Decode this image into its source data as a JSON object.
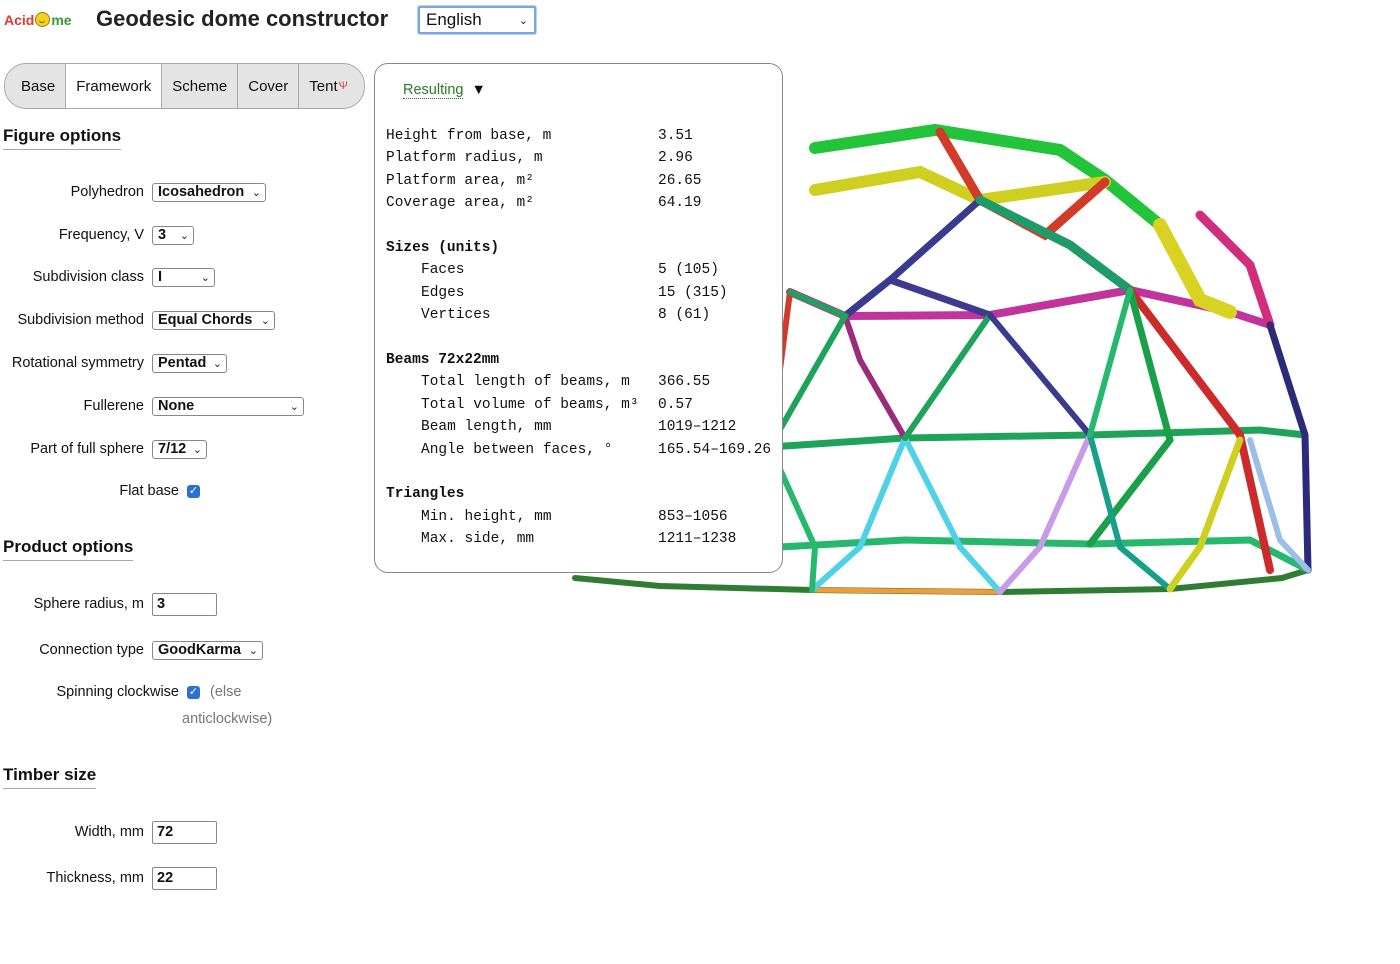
{
  "header": {
    "logo": {
      "part1": "Acid",
      "part2": "me"
    },
    "title": "Geodesic dome constructor",
    "language": "English"
  },
  "tabs": [
    {
      "label": "Base",
      "active": false
    },
    {
      "label": "Framework",
      "active": true
    },
    {
      "label": "Scheme",
      "active": false
    },
    {
      "label": "Cover",
      "active": false
    },
    {
      "label": "Tent",
      "sup": "Ψ",
      "active": false
    }
  ],
  "figure_options": {
    "title": "Figure options",
    "polyhedron": {
      "label": "Polyhedron",
      "value": "Icosahedron"
    },
    "frequency": {
      "label": "Frequency, V",
      "value": "3"
    },
    "subdivision_class": {
      "label": "Subdivision class",
      "value": "I"
    },
    "subdivision_method": {
      "label": "Subdivision method",
      "value": "Equal Chords"
    },
    "rotational_symmetry": {
      "label": "Rotational symmetry",
      "value": "Pentad"
    },
    "fullerene": {
      "label": "Fullerene",
      "value": "None"
    },
    "part_of_sphere": {
      "label": "Part of full sphere",
      "value": "7/12"
    },
    "flat_base": {
      "label": "Flat base",
      "checked": true
    }
  },
  "product_options": {
    "title": "Product options",
    "sphere_radius": {
      "label": "Sphere radius, m",
      "value": "3"
    },
    "connection_type": {
      "label": "Connection type",
      "value": "GoodKarma"
    },
    "spinning": {
      "label": "Spinning clockwise",
      "checked": true,
      "note1": "(else",
      "note2": "anticlockwise)"
    }
  },
  "timber_size": {
    "title": "Timber size",
    "width": {
      "label": "Width, mm",
      "value": "72"
    },
    "thickness": {
      "label": "Thickness, mm",
      "value": "22"
    }
  },
  "results": {
    "toggle_label": "Resulting",
    "height": {
      "label": "Height from base, m",
      "value": "3.51"
    },
    "platform_radius": {
      "label": "Platform radius, m",
      "value": "2.96"
    },
    "platform_area": {
      "label": "Platform area, m²",
      "value": "26.65"
    },
    "coverage_area": {
      "label": "Coverage area, m²",
      "value": "64.19"
    },
    "sizes_title": "Sizes (units)",
    "faces": {
      "label": "Faces",
      "value": "5 (105)"
    },
    "edges": {
      "label": "Edges",
      "value": "15 (315)"
    },
    "vertices": {
      "label": "Vertices",
      "value": "8 (61)"
    },
    "beams_title": "Beams 72x22mm",
    "total_length": {
      "label": "Total length of beams, m",
      "value": "366.55"
    },
    "total_volume": {
      "label": "Total volume of beams, m³",
      "value": "0.57"
    },
    "beam_length": {
      "label": "Beam length, mm",
      "value": "1019–1212"
    },
    "angle": {
      "label": "Angle between faces, °",
      "value": "165.54–169.26"
    },
    "triangles_title": "Triangles",
    "min_height": {
      "label": "Min. height, mm",
      "value": "853–1056"
    },
    "max_side": {
      "label": "Max. side, mm",
      "value": "1211–1238"
    }
  }
}
